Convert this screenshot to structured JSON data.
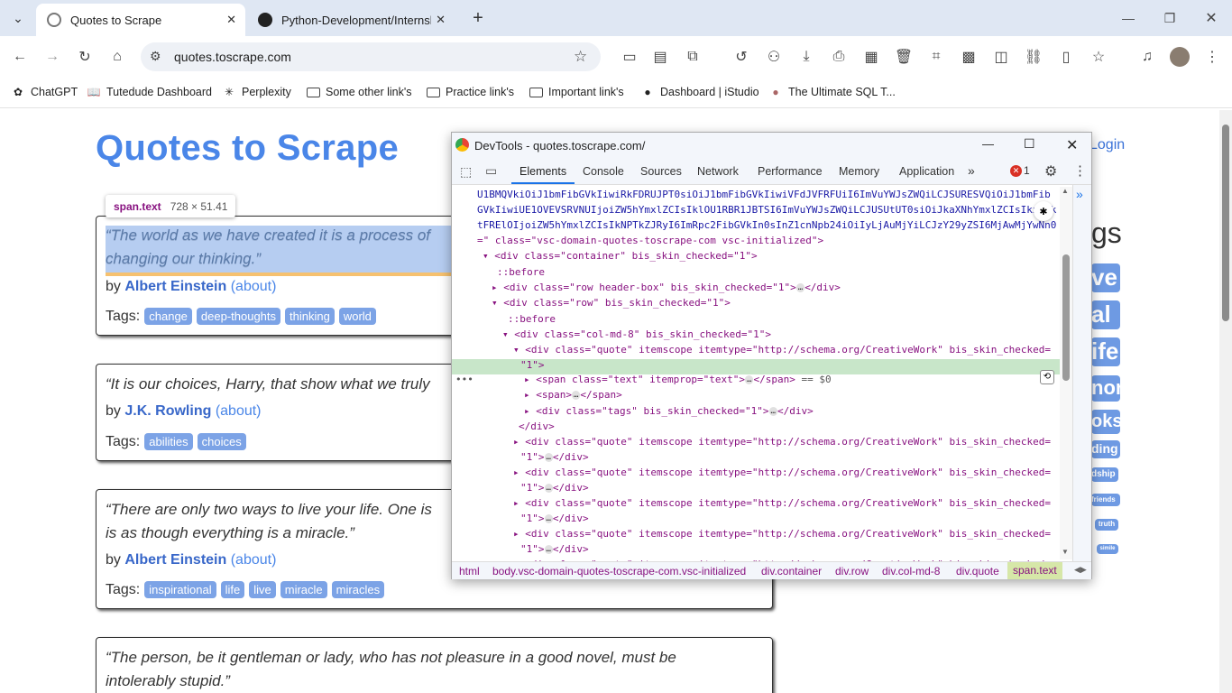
{
  "browser": {
    "tabs": [
      {
        "title": "Quotes to Scrape"
      },
      {
        "title": "Python-Development/Internship"
      }
    ],
    "url": "quotes.toscrape.com",
    "bookmarks": [
      "ChatGPT",
      "Tutedude Dashboard",
      "Perplexity",
      "Some other link's",
      "Practice link's",
      "Important link's",
      "Dashboard | iStudio",
      "The Ultimate SQL T..."
    ]
  },
  "page": {
    "title": "Quotes to Scrape",
    "login": "Login",
    "tags_heading": "gs",
    "side_tags": [
      "ve",
      "al",
      "ife",
      "nor",
      "oks",
      "ding",
      "dship",
      "friends",
      "truth",
      "simile"
    ],
    "quotes": [
      {
        "text_l1": "“The world as we have created it is a process of",
        "text_l2": "changing our thinking.”",
        "by": "by",
        "author": "Albert Einstein",
        "about": "(about)",
        "tags_label": "Tags:",
        "tags": [
          "change",
          "deep-thoughts",
          "thinking",
          "world"
        ]
      },
      {
        "text_l1": "“It is our choices, Harry, that show what we truly",
        "by": "by",
        "author": "J.K. Rowling",
        "about": "(about)",
        "tags_label": "Tags:",
        "tags": [
          "abilities",
          "choices"
        ]
      },
      {
        "text_l1": "“There are only two ways to live your life. One is",
        "text_l2": "is as though everything is a miracle.”",
        "by": "by",
        "author": "Albert Einstein",
        "about": "(about)",
        "tags_label": "Tags:",
        "tags": [
          "inspirational",
          "life",
          "live",
          "miracle",
          "miracles"
        ]
      },
      {
        "text_l1": "“The person, be it gentleman or lady, who has not pleasure in a good novel, must be",
        "text_l2": "intolerably stupid.”"
      }
    ],
    "inspect_tooltip": {
      "name": "span.text",
      "size": "728 × 51.41"
    }
  },
  "devtools": {
    "title": "DevTools - quotes.toscrape.com/",
    "tabs": [
      "Elements",
      "Console",
      "Sources",
      "Network",
      "Performance",
      "Memory",
      "Application"
    ],
    "error_count": "1",
    "code_lines": [
      "U1BMQVkiOiJ1bmFibGVkIiwiRkFDRUJPT0siOiJ1bmFibGVkIiwiVFdJVFRFUiI6ImVuYWJsZWQiLCJSURESVQiOiJ1bmFib",
      "GVkIiwiUE1OVEVSRVNUIjoiZW5hYmxlZCIsIklOU1RBR1JBTSI6ImVuYWJsZWQiLCJUSUtUT0siOiJkaXNhYmxlZCIsIkxJbk",
      "tFRElOIjoiZW5hYmxlZCIsIkNPTkZJRyI6ImRpc2FibGVkIn0sInZ1cnNpb24iOiIyLjAuMjYiLCJzY29yZSI6MjAwMjYwNn0"
    ],
    "line_body_close": "=\" class=\"vsc-domain-quotes-toscrape-com vsc-initialized\">",
    "nodes": {
      "container": "<div class=\"container\" bis_skin_checked=\"1\">",
      "before": "::before",
      "header": "<div class=\"row header-box\" bis_skin_checked=\"1\">",
      "row": "<div class=\"row\" bis_skin_checked=\"1\">",
      "col": "<div class=\"col-md-8\" bis_skin_checked=\"1\">",
      "quote": "<div class=\"quote\" itemscope itemtype=\"http://schema.org/CreativeWork\" bis_skin_checked=",
      "quote_cont": "\"1\">",
      "span_text": "<span class=\"text\" itemprop=\"text\">",
      "span_eq": "== $0",
      "span": "<span>",
      "tags": "<div class=\"tags\" bis_skin_checked=\"1\">",
      "div_close": "</div>",
      "span_close": "</span>"
    },
    "breadcrumbs": [
      "html",
      "body.vsc-domain-quotes-toscrape-com.vsc-initialized",
      "div.container",
      "div.row",
      "div.col-md-8",
      "div.quote",
      "span.text"
    ]
  }
}
